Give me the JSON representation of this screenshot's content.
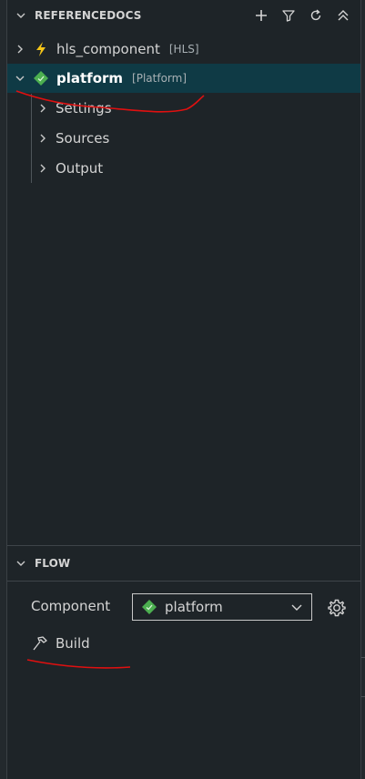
{
  "explorer": {
    "title": "REFERENCEDOCS",
    "actions": [
      "add-icon",
      "filter-icon",
      "refresh-icon",
      "collapse-all-icon"
    ],
    "items": [
      {
        "label": "hls_component",
        "tag": "[HLS]",
        "icon": "lightning-icon",
        "expanded": false
      },
      {
        "label": "platform",
        "tag": "[Platform]",
        "icon": "platform-icon",
        "expanded": true,
        "selected": true,
        "children": [
          {
            "label": "Settings"
          },
          {
            "label": "Sources"
          },
          {
            "label": "Output"
          }
        ]
      }
    ]
  },
  "flow": {
    "title": "FLOW",
    "component_label": "Component",
    "component_value": "platform",
    "build_label": "Build"
  },
  "colors": {
    "background": "#1e2428",
    "selection": "#0f3a45",
    "lightning": "#f5c518",
    "platform_icon": "#4caf50",
    "annotation": "#e01010"
  }
}
